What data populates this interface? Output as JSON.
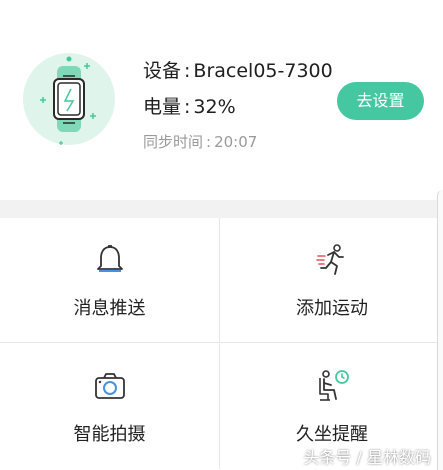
{
  "device": {
    "name_label": "设备",
    "name_value": "Bracel05-7300",
    "battery_label": "电量",
    "battery_value": "32%",
    "sync_label": "同步时间",
    "sync_value": "20:07",
    "separator": ":",
    "settings_button": "去设置",
    "icon": "fitness-band-icon"
  },
  "grid": {
    "tiles": [
      {
        "label": "消息推送",
        "icon": "bell-icon"
      },
      {
        "label": "添加运动",
        "icon": "running-person-icon"
      },
      {
        "label": "智能拍摄",
        "icon": "camera-icon"
      },
      {
        "label": "久坐提醒",
        "icon": "sitting-clock-icon"
      }
    ]
  },
  "watermark": "头条号 / 星林数码",
  "colors": {
    "accent": "#45c7a1",
    "avatar_bg": "#dff5ec",
    "divider": "#f2f2f2",
    "muted_text": "#9a9a9a"
  }
}
